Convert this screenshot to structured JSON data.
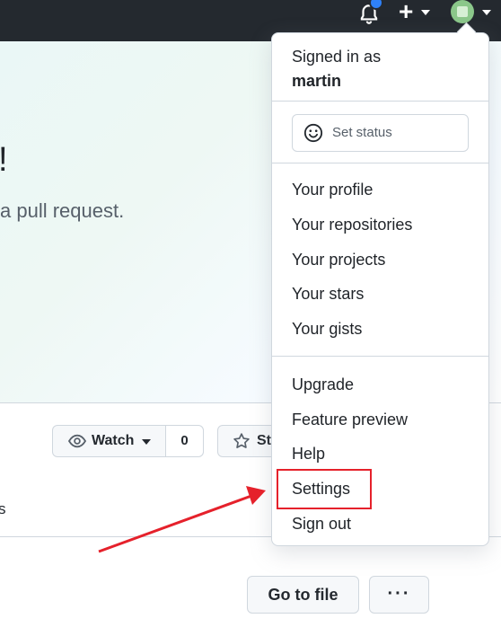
{
  "header": {
    "icons": [
      "bell-icon",
      "plus-icon",
      "avatar"
    ]
  },
  "hero": {
    "title": "!",
    "subtitle": "a pull request."
  },
  "repo_actions": {
    "watch_label": "Watch",
    "watch_count": "0",
    "star_label": "Star"
  },
  "tab_partial": "s",
  "file_actions": {
    "go_to_file": "Go to file",
    "more": "···"
  },
  "user_menu": {
    "signed_in_label": "Signed in as",
    "username": "martin",
    "set_status": "Set status",
    "items_group1": [
      "Your profile",
      "Your repositories",
      "Your projects",
      "Your stars",
      "Your gists"
    ],
    "items_group2": [
      "Upgrade",
      "Feature preview",
      "Help",
      "Settings",
      "Sign out"
    ]
  },
  "annotation": {
    "highlight_color": "#e5212b"
  }
}
